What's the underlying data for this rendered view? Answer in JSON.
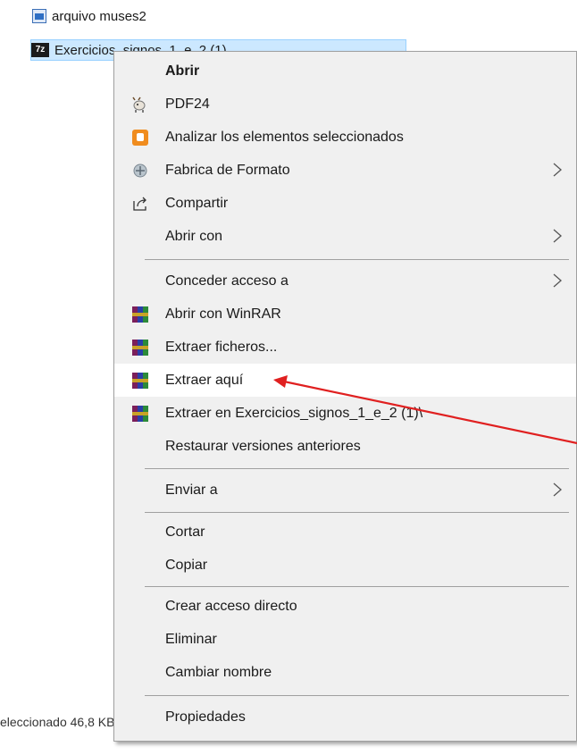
{
  "explorer": {
    "files": [
      {
        "name": "arquivo muses2",
        "icon": "image-file-icon"
      },
      {
        "name": "Exercicios_signos_1_e_2 (1)",
        "icon": "7z-archive-icon",
        "icon_text": "7z"
      }
    ],
    "status": "eleccionado  46,8 KB"
  },
  "context_menu": {
    "items": [
      {
        "label": "Abrir",
        "bold": true
      },
      {
        "label": "PDF24",
        "icon": "pdf24-goat-icon"
      },
      {
        "label": "Analizar los elementos seleccionados",
        "icon": "avast-icon"
      },
      {
        "label": "Fabrica de Formato",
        "icon": "format-factory-icon",
        "submenu": true
      },
      {
        "label": "Compartir",
        "icon": "share-icon"
      },
      {
        "label": "Abrir con",
        "submenu": true
      },
      {
        "label": "Conceder acceso a",
        "submenu": true
      },
      {
        "label": "Abrir con WinRAR",
        "icon": "winrar-icon"
      },
      {
        "label": "Extraer ficheros...",
        "icon": "winrar-icon"
      },
      {
        "label": "Extraer aquí",
        "icon": "winrar-icon",
        "highlighted": true
      },
      {
        "label": "Extraer en Exercicios_signos_1_e_2 (1)\\",
        "icon": "winrar-icon"
      },
      {
        "label": "Restaurar versiones anteriores"
      },
      {
        "label": "Enviar a",
        "submenu": true
      },
      {
        "label": "Cortar"
      },
      {
        "label": "Copiar"
      },
      {
        "label": "Crear acceso directo"
      },
      {
        "label": "Eliminar"
      },
      {
        "label": "Cambiar nombre"
      },
      {
        "label": "Propiedades"
      }
    ]
  },
  "colors": {
    "menu_background": "#f0f0f0",
    "hover_background": "#ffffff",
    "selection_background": "#cce8ff",
    "annotation_arrow": "#e02020"
  }
}
